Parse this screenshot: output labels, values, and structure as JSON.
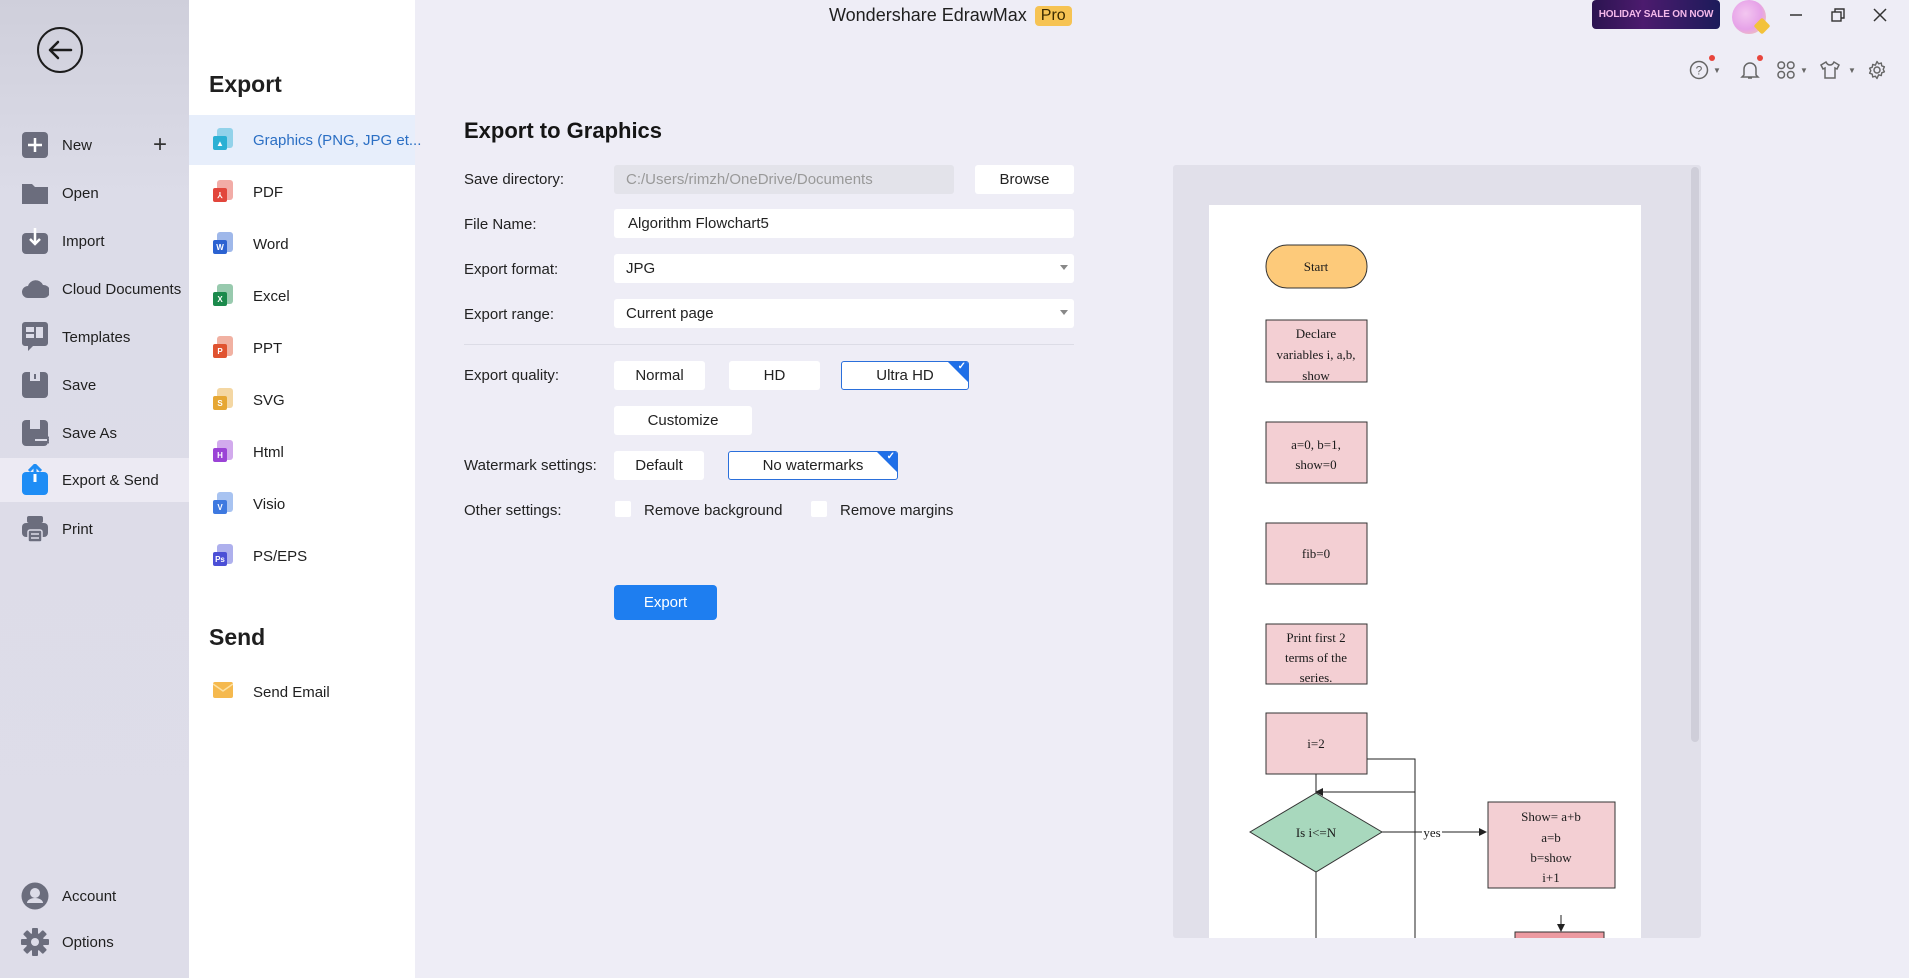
{
  "app": {
    "title": "Wondershare EdrawMax",
    "badge": "Pro",
    "promo": "HOLIDAY SALE ON NOW"
  },
  "nav": {
    "items": [
      {
        "label": "New",
        "icon": "plus-square-icon"
      },
      {
        "label": "Open",
        "icon": "folder-icon"
      },
      {
        "label": "Import",
        "icon": "import-icon"
      },
      {
        "label": "Cloud Documents",
        "icon": "cloud-icon"
      },
      {
        "label": "Templates",
        "icon": "templates-icon"
      },
      {
        "label": "Save",
        "icon": "save-icon"
      },
      {
        "label": "Save As",
        "icon": "save-as-icon"
      },
      {
        "label": "Export & Send",
        "icon": "export-icon",
        "active": true
      },
      {
        "label": "Print",
        "icon": "printer-icon"
      }
    ],
    "bottom": [
      {
        "label": "Account",
        "icon": "account-icon"
      },
      {
        "label": "Options",
        "icon": "gear-icon"
      }
    ]
  },
  "panel": {
    "export_heading": "Export",
    "formats": [
      {
        "label": "Graphics (PNG, JPG et...",
        "letter": "",
        "color": "#2bb0d4",
        "active": true
      },
      {
        "label": "PDF",
        "letter": "⅄",
        "color": "#e2463c"
      },
      {
        "label": "Word",
        "letter": "W",
        "color": "#2b62d1"
      },
      {
        "label": "Excel",
        "letter": "X",
        "color": "#1b8a4c"
      },
      {
        "label": "PPT",
        "letter": "P",
        "color": "#e05330"
      },
      {
        "label": "SVG",
        "letter": "S",
        "color": "#e6a733"
      },
      {
        "label": "Html",
        "letter": "H",
        "color": "#9b43d6"
      },
      {
        "label": "Visio",
        "letter": "V",
        "color": "#3e79e0"
      },
      {
        "label": "PS/EPS",
        "letter": "Ps",
        "color": "#4b4fd6"
      }
    ],
    "send_heading": "Send",
    "send_items": [
      {
        "label": "Send Email",
        "color": "#f5b94e"
      }
    ]
  },
  "form": {
    "title": "Export to Graphics",
    "save_directory": {
      "label": "Save directory:",
      "value": "C:/Users/rimzh/OneDrive/Documents",
      "browse": "Browse"
    },
    "file_name": {
      "label": "File Name:",
      "value": "Algorithm Flowchart5"
    },
    "export_format": {
      "label": "Export format:",
      "value": "JPG"
    },
    "export_range": {
      "label": "Export range:",
      "value": "Current page"
    },
    "quality": {
      "label": "Export quality:",
      "options": [
        "Normal",
        "HD",
        "Ultra HD"
      ],
      "selected": "Ultra HD",
      "customize": "Customize"
    },
    "watermark": {
      "label": "Watermark settings:",
      "options": [
        "Default",
        "No watermarks"
      ],
      "selected": "No watermarks"
    },
    "other": {
      "label": "Other settings:",
      "remove_background": "Remove background",
      "remove_margins": "Remove margins",
      "remove_background_checked": false,
      "remove_margins_checked": false
    },
    "export_button": "Export"
  },
  "preview": {
    "flowchart": {
      "start": "Start",
      "declare": [
        "Declare",
        "variables i, a,b,",
        "show"
      ],
      "init": [
        "a=0, b=1,",
        "show=0"
      ],
      "fib": "fib=0",
      "print": [
        "Print first 2",
        "terms of the",
        "series."
      ],
      "i_init": "i=2",
      "decision": "Is i<=N",
      "yes_label": "yes",
      "loop_body": [
        "Show= a+b",
        "a=b",
        "b=show",
        "i+1"
      ]
    }
  }
}
